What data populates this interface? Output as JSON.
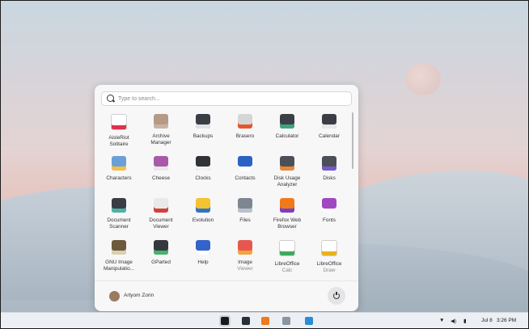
{
  "search": {
    "placeholder": "Type to search..."
  },
  "apps": [
    {
      "label": "AisleRiot\nSolitaire",
      "color": "#ffffff",
      "accent": "#e0304b"
    },
    {
      "label": "Archive\nManager",
      "color": "#b59a86",
      "accent": "#cbb3a1"
    },
    {
      "label": "Backups",
      "color": "#3a3d44",
      "accent": "#dfe3e8"
    },
    {
      "label": "Brasero",
      "color": "#d6d6d6",
      "accent": "#e4572e"
    },
    {
      "label": "Calculator",
      "color": "#3c4046",
      "accent": "#3ea57e"
    },
    {
      "label": "Calendar",
      "color": "#3a3d44",
      "accent": "#e8e8e8"
    },
    {
      "label": "Characters",
      "color": "#6aa0d8",
      "accent": "#f2c04b"
    },
    {
      "label": "Cheese",
      "color": "#a85aa8",
      "accent": "#e9e9e9"
    },
    {
      "label": "Clocks",
      "color": "#2f3338",
      "accent": "#f1f1f1"
    },
    {
      "label": "Contacts",
      "color": "#2b62c4",
      "accent": "#ffffff"
    },
    {
      "label": "Disk Usage\nAnalyzer",
      "color": "#4b5058",
      "accent": "#e98936"
    },
    {
      "label": "Disks",
      "color": "#4b5058",
      "accent": "#7659c8"
    },
    {
      "label": "Document\nScanner",
      "color": "#3a3d44",
      "accent": "#4fb0a6"
    },
    {
      "label": "Document\nViewer",
      "color": "#e9e9ec",
      "accent": "#d0413f"
    },
    {
      "label": "Evolution",
      "color": "#f4c430",
      "accent": "#2f73c9"
    },
    {
      "label": "Files",
      "color": "#7d8691",
      "accent": "#b9c2cb"
    },
    {
      "label": "Firefox Web\nBrowser",
      "color": "#f07a1a",
      "accent": "#7b3fc4"
    },
    {
      "label": "Fonts",
      "color": "#a047c4",
      "accent": "#ffffff"
    },
    {
      "label": "GNU Image\nManipulatio...",
      "color": "#6c5a3a",
      "accent": "#d9d0b2"
    },
    {
      "label": "GParted",
      "color": "#35393f",
      "accent": "#45b36b"
    },
    {
      "label": "Help",
      "color": "#3463c9",
      "accent": "#ffffff"
    },
    {
      "label": "Image",
      "sub": "Viewer",
      "color": "#e75750",
      "accent": "#f2a53e"
    },
    {
      "label": "LibreOffice",
      "sub": "Calc",
      "color": "#ffffff",
      "accent": "#41a95f"
    },
    {
      "label": "LibreOffice",
      "sub": "Draw",
      "color": "#ffffff",
      "accent": "#e8b21c"
    }
  ],
  "user": {
    "name": "Artyom Zorin"
  },
  "taskbar": {
    "items": [
      {
        "name": "zorin-menu",
        "color": "#1a1a1a",
        "bg": "#cfd5db"
      },
      {
        "name": "multitasking",
        "color": "#26313b",
        "bg": "transparent"
      },
      {
        "name": "firefox",
        "color": "#f07a1a",
        "bg": "transparent"
      },
      {
        "name": "files",
        "color": "#8a95a2",
        "bg": "transparent"
      },
      {
        "name": "software",
        "color": "#2a8dd4",
        "bg": "transparent"
      }
    ],
    "date": "Jul 8",
    "time": "3:26 PM"
  }
}
